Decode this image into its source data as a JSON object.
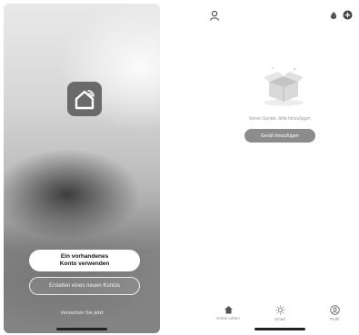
{
  "login_screen": {
    "logo_icon": "smart-home-wifi-icon",
    "login_button_line1": "Ein vorhandenes",
    "login_button_line2": "Konto verwenden",
    "register_button": "Erstellen eines neuen Kontos",
    "try_link": "Versuchen Sie jetzt"
  },
  "device_screen": {
    "icons": {
      "profile": "user-icon",
      "voice": "voice-assistant-icon",
      "add": "add-circle-icon"
    },
    "empty_text": "Keine Geräte, bitte hinzufügen",
    "add_button": "Gerät hinzufügen",
    "tabs": [
      {
        "label": "Home Leben",
        "icon": "home-icon"
      },
      {
        "label": "Smart",
        "icon": "sun-icon"
      },
      {
        "label": "Profil",
        "icon": "profile-icon"
      }
    ]
  },
  "colors": {
    "button_gray": "#8c8c8c",
    "logo_bg": "#6a6a6a"
  }
}
